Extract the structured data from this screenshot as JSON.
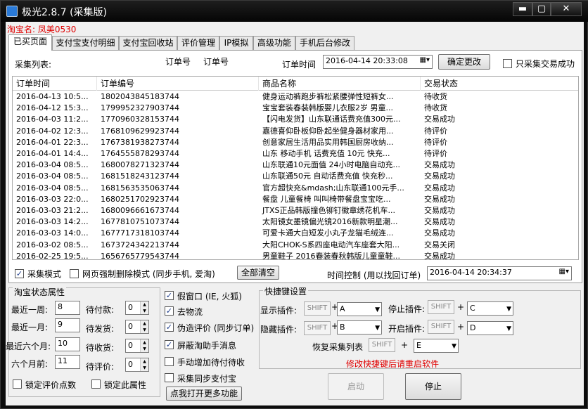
{
  "window": {
    "title": "极光2.8.7  (采集版)",
    "min": "▬",
    "max": "▢",
    "close": "✕"
  },
  "shop_label": "淘宝名:  凤美0530",
  "tabs": [
    "已买页面",
    "支付宝支付明细",
    "支付宝回收站",
    "评价管理",
    "IP模拟",
    "高级功能",
    "手机后台修改"
  ],
  "toolbar": {
    "collect_list_label": "采集列表:",
    "order_no_a": "订单号",
    "order_no_b": "订单号",
    "order_time_label": "订单时间",
    "order_time_value": "2016-04-14 20:33:08",
    "confirm_button": "确定更改",
    "only_success_label": "只采集交易成功"
  },
  "grid": {
    "columns": [
      "订单时间",
      "订单编号",
      "商品名称",
      "交易状态"
    ],
    "rows": [
      [
        "2016-04-13 10:5...",
        "1802043845183744",
        "健身运动裤跑步裤松紧腰弹性短裤女...",
        "待收货"
      ],
      [
        "2016-04-12 15:3...",
        "1799952327903744",
        "宝宝套装春装韩版婴儿衣服2岁 男童...",
        "待收货"
      ],
      [
        "2016-04-03 11:2...",
        "1770960328153744",
        "【闪电发货】山东联通话费充值300元...",
        "交易成功"
      ],
      [
        "2016-04-02 12:3...",
        "1768109629923744",
        "嘉德喜仰卧板仰卧起坐健身器材家用...",
        "待评价"
      ],
      [
        "2016-04-01 22:3...",
        "1767381938273744",
        "创意家居生活用品实用韩国厨房收纳...",
        "待评价"
      ],
      [
        "2016-04-01 14:4...",
        "1764555878293744",
        "山东  移动手机 话费充值 10元 快充...",
        "待评价"
      ],
      [
        "2016-03-04 08:5...",
        "1680078271323744",
        "山东联通10元面值 24小时电脑自动充...",
        "交易成功"
      ],
      [
        "2016-03-04 08:5...",
        "1681518243123744",
        "山东联通50元 自动话费充值 快充秒...",
        "交易成功"
      ],
      [
        "2016-03-04 08:5...",
        "1681563535063744",
        "官方超快充&mdash;山东联通100元手...",
        "交易成功"
      ],
      [
        "2016-03-03 22:0...",
        "1680251702923744",
        "餐盘 儿童餐椅 叫叫椅带餐盘宝宝吃...",
        "交易成功"
      ],
      [
        "2016-03-03 21:2...",
        "1680096661673744",
        "JTXS正品韩版撞色铆钉徽章绣花机车...",
        "交易成功"
      ],
      [
        "2016-03-03 14:2...",
        "1677810751073744",
        "太阳镜女墨镜偏光镜2016新款明星潮...",
        "交易成功"
      ],
      [
        "2016-03-03 14:0...",
        "1677717318103744",
        "可爱卡通大白短发小丸子龙猫毛绒连...",
        "交易成功"
      ],
      [
        "2016-03-02 08:5...",
        "1673724342213744",
        "大阳CHOK-S系四座电动汽车座套大阳...",
        "交易关闭"
      ],
      [
        "2016-02-25 19:5...",
        "1656765779543744",
        "男童鞋子 2016春装春秋韩版儿童童鞋...",
        "交易成功"
      ]
    ]
  },
  "bottom_bar": {
    "collect_mode": "采集模式",
    "force_delete_mode": "网页强制删除模式 (同步手机, 爱淘)",
    "clear_all": "全部清空",
    "time_control_label": "时间控制 (用以找回订单)",
    "time_control_value": "2016-04-14 20:34:37"
  },
  "taobao_props": {
    "title": "淘宝状态属性",
    "week_label": "最近一周:",
    "week_value": "8",
    "month_label": "最近一月:",
    "month_value": "9",
    "six_month_label": "最近六个月:",
    "six_month_value": "10",
    "before_six_label": "六个月前:",
    "before_six_value": "11",
    "pending_pay_label": "待付款:",
    "pending_pay_value": "0",
    "pending_ship_label": "待发货:",
    "pending_ship_value": "0",
    "pending_recv_label": "待收货:",
    "pending_recv_value": "0",
    "pending_review_label": "待评价:",
    "pending_review_value": "0",
    "lock_review_points": "锁定评价点数",
    "lock_props": "锁定此属性"
  },
  "options": {
    "fake_window": "假窗口 (IE, 火狐)",
    "remove_logistics": "去物流",
    "fake_review": "伪造评价 (同步订单)",
    "block_aitao": "屏蔽淘助手消息",
    "manual_add_pending": "手动增加待付待收",
    "collect_sync_alipay": "采集同步支付宝",
    "open_more": "点我打开更多功能"
  },
  "hotkeys": {
    "title": "快捷键设置",
    "show_plugin": "显示插件:",
    "stop_plugin": "停止插件:",
    "hide_plugin": "隐藏插件:",
    "open_plugin": "开启插件:",
    "restore_list": "恢复采集列表",
    "shift": "SHIFT",
    "plus": "+",
    "key_show": "A",
    "key_stop": "C",
    "key_hide": "B",
    "key_open": "D",
    "key_restore": "E",
    "restart_note": "修改快捷键后请重启软件"
  },
  "actions": {
    "start": "启动",
    "stop": "停止"
  },
  "icons": {
    "app": "app-icon",
    "calendar": "calendar-icon",
    "dropdown": "chevron-down-icon"
  },
  "colors": {
    "accent_red": "#e00000",
    "titlebar": "#0c0c0c"
  }
}
